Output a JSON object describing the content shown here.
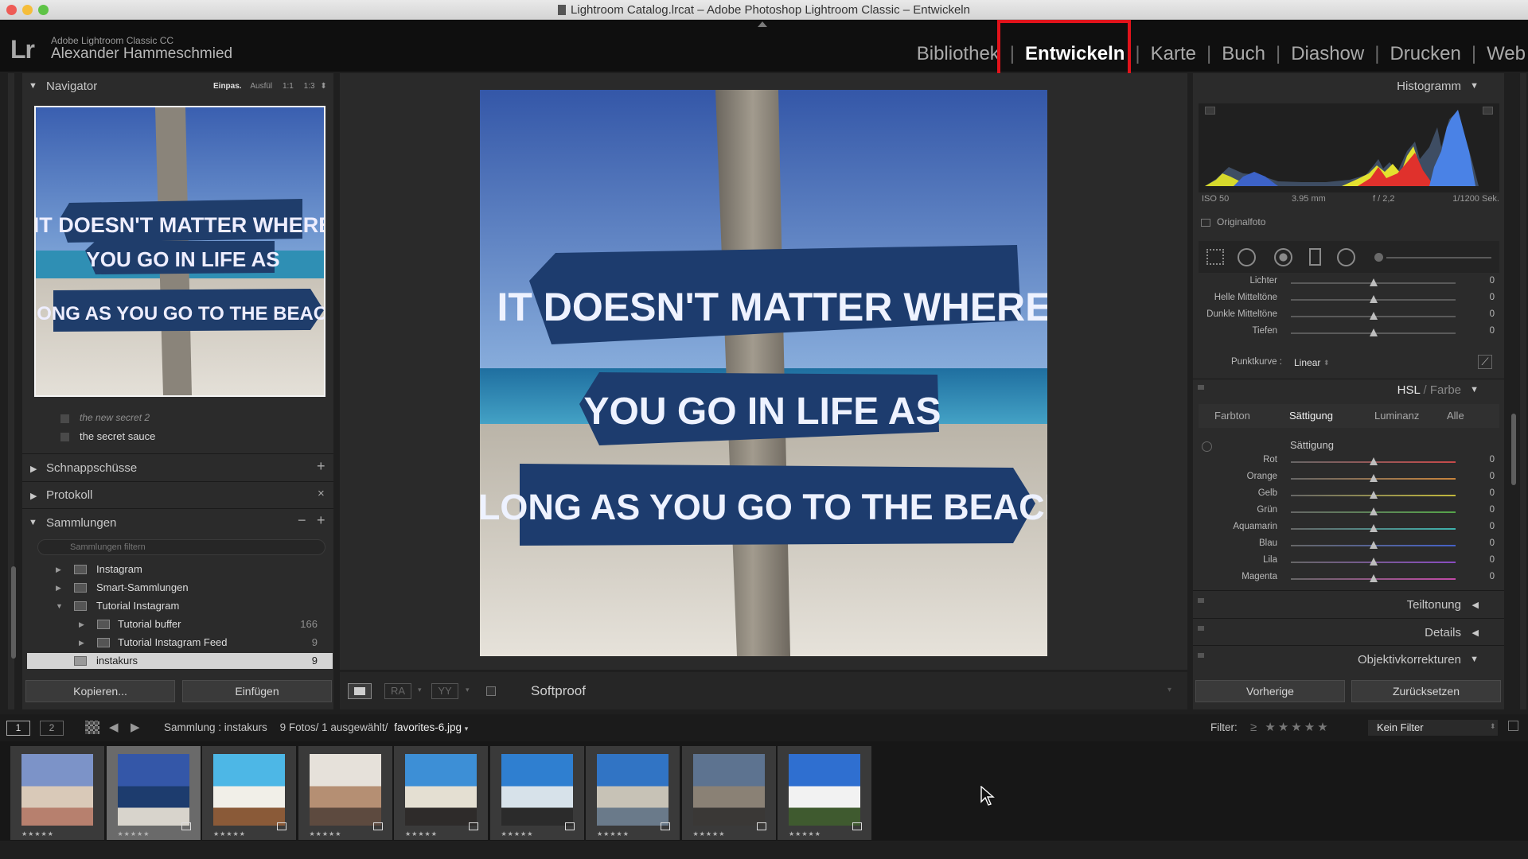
{
  "window": {
    "title": "Lightroom Catalog.lrcat – Adobe Photoshop Lightroom Classic – Entwickeln"
  },
  "brand": {
    "logo": "Lr",
    "product": "Adobe Lightroom Classic CC",
    "user": "Alexander Hammeschmied"
  },
  "modules": [
    "Bibliothek",
    "Entwickeln",
    "Karte",
    "Buch",
    "Diashow",
    "Drucken",
    "Web"
  ],
  "active_module": "Entwickeln",
  "navigator": {
    "title": "Navigator",
    "zoom_options": [
      "Einpas.",
      "Ausfül",
      "1:1",
      "1:3"
    ]
  },
  "photo_text": [
    "IT DOESN'T MATTER WHERE",
    "YOU GO IN LIFE AS",
    "LONG AS YOU GO TO THE BEACH"
  ],
  "presets": {
    "items": [
      "the new secret 2",
      "the secret sauce"
    ]
  },
  "left_panels": {
    "snapshots": "Schnappschüsse",
    "history": "Protokoll",
    "collections": "Sammlungen"
  },
  "collections": {
    "filter_placeholder": "Sammlungen filtern",
    "items": [
      {
        "name": "Instagram",
        "count": ""
      },
      {
        "name": "Smart-Sammlungen",
        "count": ""
      },
      {
        "name": "Tutorial Instagram",
        "count": ""
      },
      {
        "name": "Tutorial buffer",
        "count": "166"
      },
      {
        "name": "Tutorial Instagram Feed",
        "count": "9"
      },
      {
        "name": "instakurs",
        "count": "9"
      }
    ]
  },
  "left_buttons": {
    "copy": "Kopieren...",
    "paste": "Einfügen"
  },
  "toolbar": {
    "softproof": "Softproof"
  },
  "histogram": {
    "title": "Histogramm",
    "iso": "ISO 50",
    "focal": "3.95 mm",
    "aperture": "f / 2,2",
    "shutter": "1/1200 Sek.",
    "original": "Originalfoto"
  },
  "tone_curve": {
    "sliders": [
      {
        "label": "Lichter",
        "value": "0",
        "level": 0.5
      },
      {
        "label": "Helle Mitteltöne",
        "value": "0",
        "level": 0.5
      },
      {
        "label": "Dunkle Mitteltöne",
        "value": "0",
        "level": 0.5
      },
      {
        "label": "Tiefen",
        "value": "0",
        "level": 0.5
      }
    ],
    "point_curve_label": "Punktkurve :",
    "point_curve_value": "Linear"
  },
  "hsl": {
    "title_hsl": "HSL",
    "title_sep": " / ",
    "title_color": "Farbe",
    "tabs": [
      "Farbton",
      "Sättigung",
      "Luminanz",
      "Alle"
    ],
    "active_tab": "Sättigung",
    "section_title": "Sättigung",
    "sliders": [
      {
        "label": "Rot",
        "value": "0",
        "level": 0.5,
        "color": "#c84a4a"
      },
      {
        "label": "Orange",
        "value": "0",
        "level": 0.5,
        "color": "#c8843c"
      },
      {
        "label": "Gelb",
        "value": "0",
        "level": 0.5,
        "color": "#c2b83c"
      },
      {
        "label": "Grün",
        "value": "0",
        "level": 0.5,
        "color": "#55a54a"
      },
      {
        "label": "Aquamarin",
        "value": "0",
        "level": 0.5,
        "color": "#3db2ad"
      },
      {
        "label": "Blau",
        "value": "0",
        "level": 0.5,
        "color": "#4561c8"
      },
      {
        "label": "Lila",
        "value": "0",
        "level": 0.5,
        "color": "#8a4cc2"
      },
      {
        "label": "Magenta",
        "value": "0",
        "level": 0.5,
        "color": "#c24aa8"
      }
    ]
  },
  "right_panels": {
    "split_toning": "Teiltonung",
    "details": "Details",
    "lens": "Objektivkorrekturen"
  },
  "right_buttons": {
    "previous": "Vorherige",
    "reset": "Zurücksetzen"
  },
  "filmstrip_bar": {
    "view1": "1",
    "view2": "2",
    "source": "Sammlung : instakurs",
    "count": "9 Fotos/ 1 ausgewählt/",
    "filename": "favorites-6.jpg",
    "filter_label": "Filter:",
    "filter_value": "Kein Filter"
  },
  "filmstrip": {
    "stars": "★★★★★",
    "count": 9,
    "selected_index": 1
  },
  "colors": {
    "accent_red": "#e1131b",
    "panel_bg": "#2b2b2b",
    "header_bg": "#0f0f0f"
  }
}
